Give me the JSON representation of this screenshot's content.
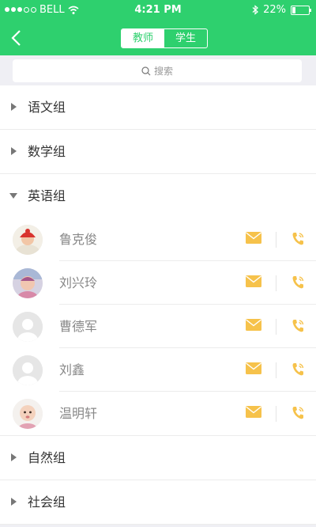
{
  "status_bar": {
    "carrier": "BELL",
    "time": "4:21 PM",
    "battery": "22%",
    "battery_level": 0.22
  },
  "header": {
    "tabs": [
      {
        "label": "教师",
        "active": true
      },
      {
        "label": "学生",
        "active": false
      }
    ]
  },
  "search": {
    "placeholder": "搜索"
  },
  "groups_before": [
    {
      "label": "语文组"
    },
    {
      "label": "数学组"
    }
  ],
  "expanded_group": {
    "label": "英语组",
    "members": [
      {
        "name": "鲁克俊"
      },
      {
        "name": "刘兴玲"
      },
      {
        "name": "曹德军"
      },
      {
        "name": "刘鑫"
      },
      {
        "name": "温明轩"
      }
    ]
  },
  "groups_after": [
    {
      "label": "自然组"
    },
    {
      "label": "社会组"
    }
  ],
  "colors": {
    "primary": "#2ed06e",
    "icon_accent": "#f6c24b"
  }
}
